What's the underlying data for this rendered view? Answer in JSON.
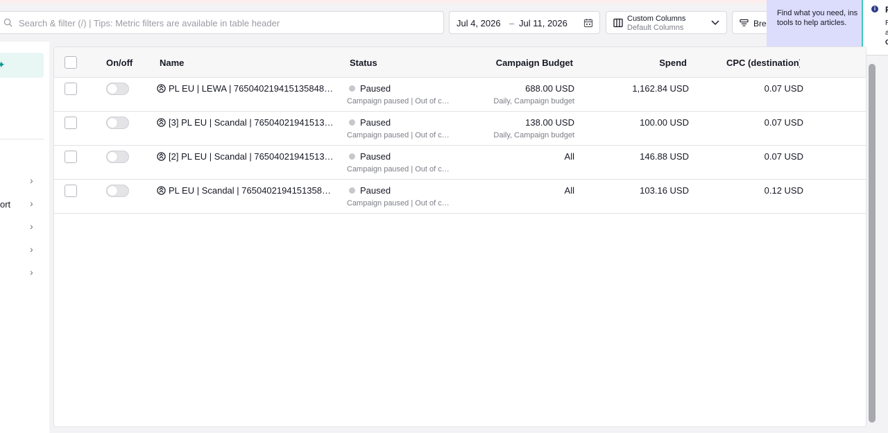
{
  "toolbar": {
    "search_placeholder": "Search & filter (/) | Tips: Metric filters are available in table header",
    "date_start": "Jul 4, 2026",
    "date_sep": "–",
    "date_end": "Jul 11, 2026",
    "columns_title": "Custom Columns",
    "columns_selected": "Default Columns",
    "breakdown_label": "Brea"
  },
  "help_popover": {
    "line1": "Find what you need, ins",
    "line2": "tools to help articles."
  },
  "info_panel": {
    "title": "F",
    "line1": "R",
    "line2": "a",
    "line3": "C"
  },
  "sidebar": {
    "partial_label": "ort"
  },
  "table": {
    "headers": {
      "onoff": "On/off",
      "name": "Name",
      "status": "Status",
      "budget": "Campaign Budget",
      "spend": "Spend",
      "cpc": "CPC (destination)"
    },
    "rows": [
      {
        "name": "PL EU | LEWA | 765040219415135848…",
        "status": "Paused",
        "status_detail": "Campaign paused | Out of c…",
        "budget": "688.00 USD",
        "budget_detail": "Daily, Campaign budget",
        "spend": "1,162.84 USD",
        "cpc": "0.07 USD"
      },
      {
        "name": "[3] PL EU | Scandal | 76504021941513…",
        "status": "Paused",
        "status_detail": "Campaign paused | Out of c…",
        "budget": "138.00 USD",
        "budget_detail": "Daily, Campaign budget",
        "spend": "100.00 USD",
        "cpc": "0.07 USD"
      },
      {
        "name": "[2] PL EU | Scandal | 76504021941513…",
        "status": "Paused",
        "status_detail": "Campaign paused | Out of c…",
        "budget": "All",
        "budget_detail": "",
        "spend": "146.88 USD",
        "cpc": "0.07 USD"
      },
      {
        "name": "PL EU | Scandal | 7650402194151358…",
        "status": "Paused",
        "status_detail": "Campaign paused | Out of c…",
        "budget": "All",
        "budget_detail": "",
        "spend": "103.16 USD",
        "cpc": "0.12 USD"
      }
    ]
  },
  "colors": {
    "accent": "#0f9b8e",
    "paused_dot": "#c7c8cd",
    "popover_bg": "#dcdcfc"
  }
}
